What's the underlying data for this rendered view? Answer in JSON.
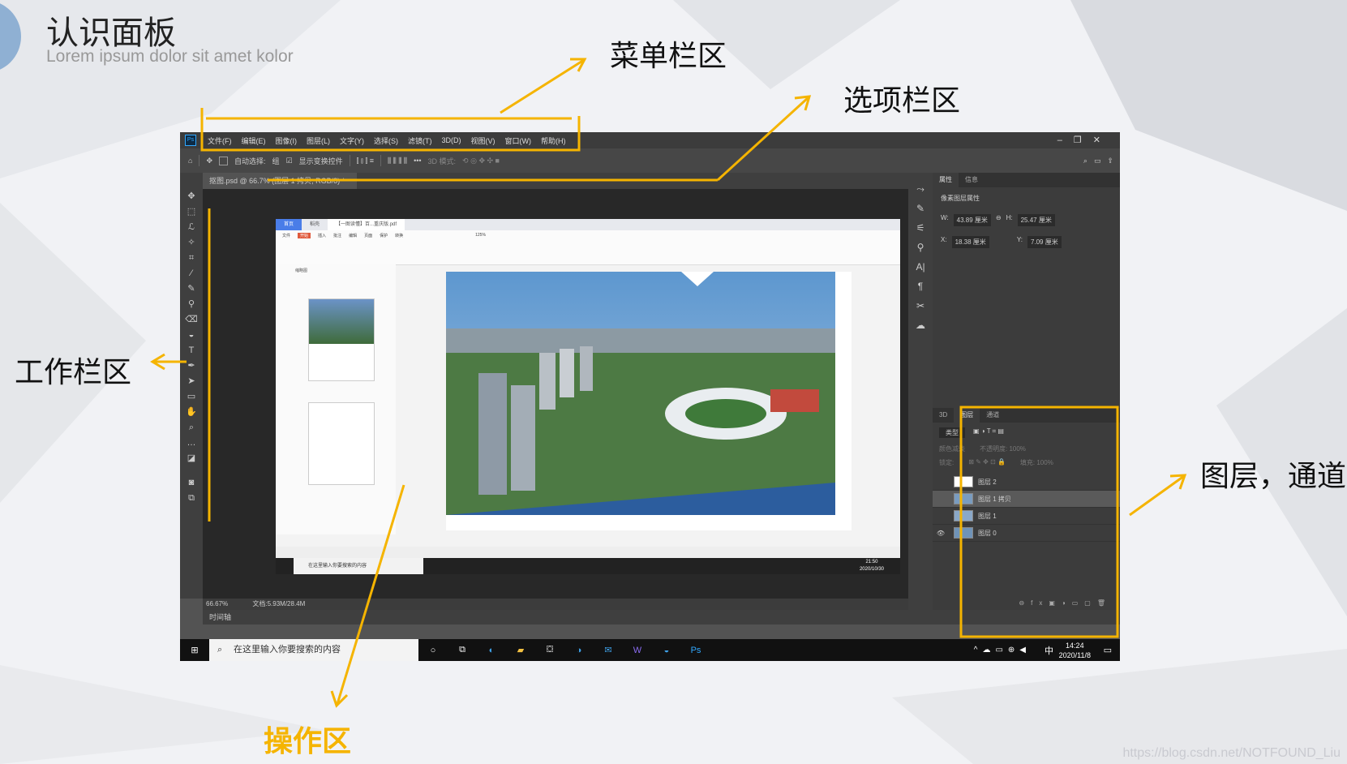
{
  "slide": {
    "title": "认识面板",
    "subtitle": "Lorem ipsum dolor sit amet kolor"
  },
  "labels": {
    "menu_bar": "菜单栏区",
    "options_bar": "选项栏区",
    "toolbar": "工作栏区",
    "layers_channels": "图层，通道",
    "work_area": "操作区"
  },
  "photoshop": {
    "menus": [
      "文件(F)",
      "编辑(E)",
      "图像(I)",
      "图层(L)",
      "文字(Y)",
      "选择(S)",
      "滤镜(T)",
      "3D(D)",
      "视图(V)",
      "窗口(W)",
      "帮助(H)"
    ],
    "options": {
      "auto_select": "自动选择:",
      "group": "组",
      "show_transform": "显示变换控件",
      "mode_3d": "3D 模式:"
    },
    "document_tab": "抠图.psd @ 66.7% (图层 1 拷贝, RGB/8) *",
    "tools": [
      "move",
      "marquee",
      "lasso",
      "wand",
      "crop",
      "eyedropper",
      "brush",
      "stamp",
      "eraser",
      "fill",
      "type",
      "pen",
      "path-select",
      "shape",
      "hand",
      "zoom",
      "more"
    ],
    "status_zoom": "66.67%",
    "status_doc": "文档:5.93M/28.4M",
    "timeline": "时间轴",
    "properties": {
      "tabs": [
        "属性",
        "信息"
      ],
      "title": "像素图层属性",
      "w": "43.89 厘米",
      "h": "25.47 厘米",
      "x": "18.38 厘米",
      "y": "7.09 厘米"
    },
    "layers": {
      "tabs": [
        "3D",
        "图层",
        "通道"
      ],
      "filter": "类型",
      "blend": "颜色减淡",
      "opacity": "不透明度: 100%",
      "lock": "锁定:",
      "fill": "填充: 100%",
      "items": [
        "图层 2",
        "图层 1 拷贝",
        "图层 1",
        "图层 0"
      ]
    }
  },
  "pdf_viewer": {
    "tabs": [
      "首页",
      "稻壳",
      "【一图读懂】百...重庆版.pdf"
    ],
    "ribbon_tabs": [
      "文件",
      "开始",
      "插入",
      "批注",
      "编辑",
      "页面",
      "保护",
      "转换"
    ],
    "side_title": "缩略图",
    "zoom": "125%",
    "taskbar_search": "在这里输入你要搜索的内容",
    "taskbar_time": "21:50",
    "taskbar_date": "2020/10/30"
  },
  "taskbar": {
    "search": "在这里输入你要搜索的内容",
    "ime": "中",
    "time": "14:24",
    "date": "2020/11/8"
  },
  "watermark": "https://blog.csdn.net/NOTFOUND_Liu",
  "colors": {
    "accent_arrow": "#f5b400",
    "ps_bg": "#535353",
    "ps_dark": "#282828"
  }
}
